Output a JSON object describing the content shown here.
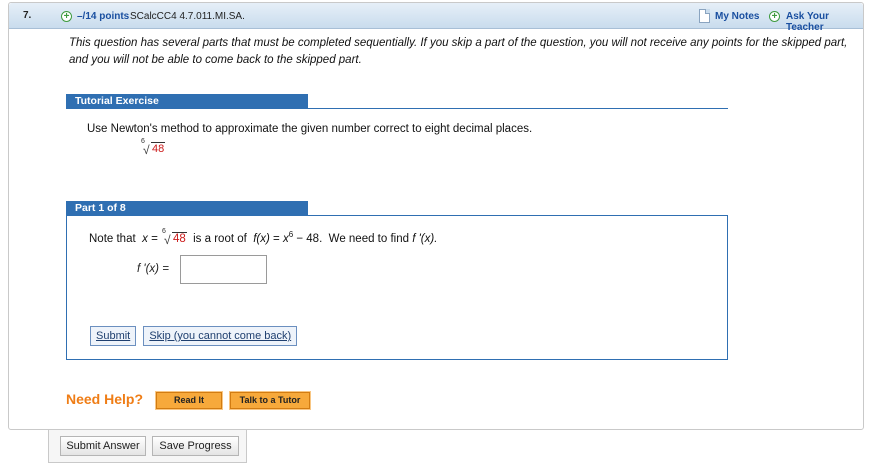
{
  "header": {
    "question_number": "7.",
    "points": "–/14 points",
    "assignment_code": "SCalcCC4 4.7.011.MI.SA.",
    "my_notes": "My Notes",
    "ask_teacher": "Ask Your Teacher"
  },
  "intro": "This question has several parts that must be completed sequentially. If you skip a part of the question, you will not receive any points for the skipped part, and you will not be able to come back to the skipped part.",
  "tutorial": {
    "title": "Tutorial Exercise",
    "prompt": "Use Newton's method to approximate the given number correct to eight decimal places.",
    "root_index": "6",
    "root_value": "48"
  },
  "part": {
    "title": "Part 1 of 8",
    "note_prefix": "Note that",
    "x_eq": "x =",
    "root_index": "6",
    "root_value": "48",
    "is_root_of": "is a root of",
    "fx": "f(x)",
    "eq": "=",
    "x_var": "x",
    "exponent": "6",
    "minus": "−",
    "const": "48.",
    "need_find": "We need to find",
    "fprime": "f '(x).",
    "input_label": "f '(x) =",
    "input_value": "",
    "submit": "Submit",
    "skip": "Skip (you cannot come back)"
  },
  "help": {
    "label": "Need Help?",
    "read_it": "Read It",
    "talk_tutor": "Talk to a Tutor"
  },
  "footer": {
    "submit_answer": "Submit Answer",
    "save_progress": "Save Progress"
  },
  "colors": {
    "accent_blue": "#2f6fb2",
    "link_blue": "#1a4fa0",
    "answer_red": "#cc1a1a",
    "help_orange": "#ef7d16",
    "button_orange": "#f7a93b"
  }
}
